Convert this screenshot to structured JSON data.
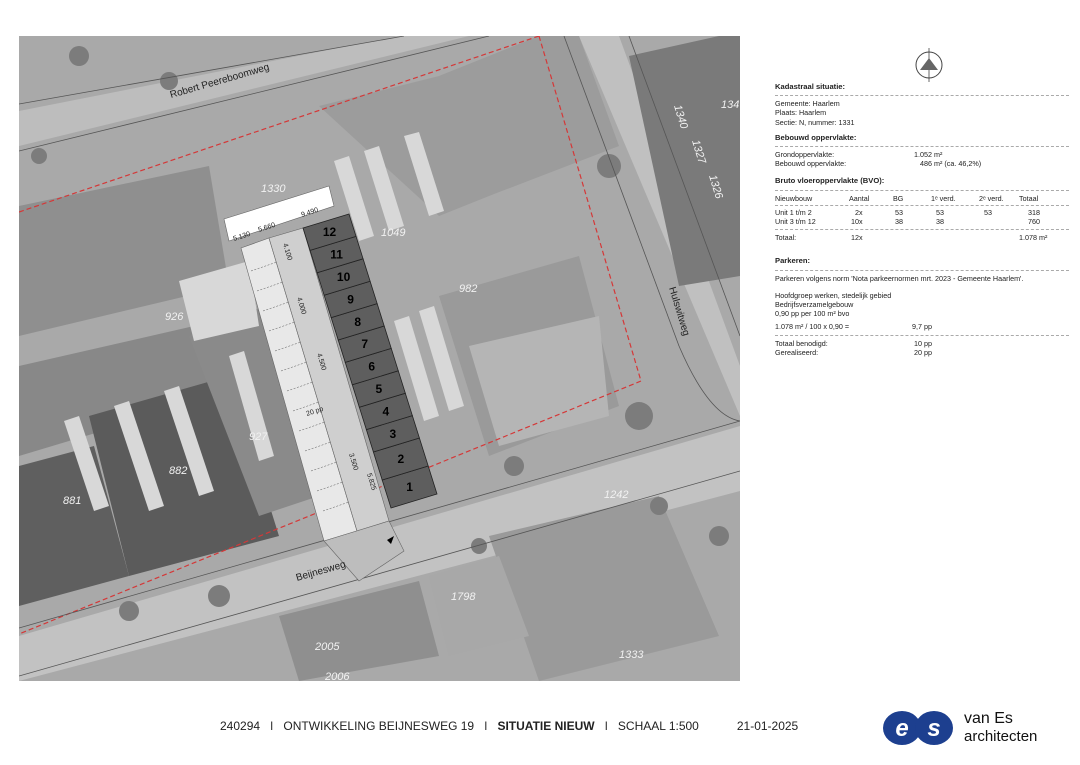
{
  "map": {
    "streets": {
      "north": "Robert Peereboomweg",
      "east": "Hulswitweg",
      "south": "Beijnesweg"
    },
    "parcel_numbers": [
      "1330",
      "1049",
      "926",
      "982",
      "927",
      "882",
      "881",
      "1242",
      "1798",
      "2005",
      "2006",
      "1333",
      "1340",
      "1327",
      "1326",
      "134"
    ],
    "units": [
      "1",
      "2",
      "3",
      "4",
      "5",
      "6",
      "7",
      "8",
      "9",
      "10",
      "11",
      "12"
    ],
    "dimensions": {
      "top_a": "5.130",
      "top_b": "5.660",
      "top_c": "9.490",
      "side": "4.500",
      "parking_width": "20 pp",
      "bottom_a": "3.500",
      "bottom_b": "5.825",
      "left_a": "4.100",
      "left_b": "4.000"
    }
  },
  "panel": {
    "kadastraal_title": "Kadastraal situatie:",
    "gemeente": "Gemeente: Haarlem",
    "plaats": "Plaats: Haarlem",
    "sectie": "Sectie: N, nummer: 1331",
    "bebouwd_title": "Bebouwd oppervlakte:",
    "grond_label": "Grondoppervlakte:",
    "grond_value": "1.052 m²",
    "bebouwd_label": "Bebouwd oppervlakte:",
    "bebouwd_value": "486 m²  (ca. 46,2%)",
    "bvo_title": "Bruto vloeroppervlakte (BVO):",
    "bvo_headers": {
      "c1": "Nieuwbouw",
      "c2": "Aantal",
      "c3": "BG",
      "c4": "1ᵉ verd.",
      "c5": "2ᵉ verd.",
      "c6": "Totaal"
    },
    "bvo_row1": {
      "c1": "Unit   1 t/m 2",
      "c2": "2x",
      "c3": "53",
      "c4": "53",
      "c5": "53",
      "c6": "318"
    },
    "bvo_row2": {
      "c1": "Unit   3 t/m 12",
      "c2": "10x",
      "c3": "38",
      "c4": "38",
      "c5": "",
      "c6": "760"
    },
    "totaal_label": "Totaal:",
    "totaal_count": "12x",
    "totaal_value": "1.078 m²",
    "parkeren_title": "Parkeren:",
    "parkeren_norm": "Parkeren volgens norm 'Nota parkeernormen mrt. 2023 - Gemeente Haarlem'.",
    "hoofdgroep": "Hoofdgroep werken, stedelijk gebied",
    "bedrijf": "Bedrijfsverzamelgebouw",
    "norm": "0,90 pp per 100 m² bvo",
    "calc_label": "1.078 m² / 100 x 0,90 =",
    "calc_value": "9,7 pp",
    "benodigd_label": "Totaal benodigd:",
    "benodigd_value": "10 pp",
    "gerealiseerd_label": "Gerealiseerd:",
    "gerealiseerd_value": "20 pp"
  },
  "footer": {
    "project_no": "240294",
    "project_name": "ONTWIKKELING BEIJNESWEG 19",
    "drawing": "SITUATIE NIEUW",
    "scale": "SCHAAL 1:500",
    "date": "21-01-2025",
    "separator": "I"
  },
  "logo": {
    "line1": "van Es",
    "line2": "architecten",
    "mark": "es"
  },
  "colors": {
    "boundary": "#d43838",
    "units_fill": "#5e5e5e",
    "parking_fill": "#c9c9c9",
    "logo_blue": "#1d3f8f"
  }
}
